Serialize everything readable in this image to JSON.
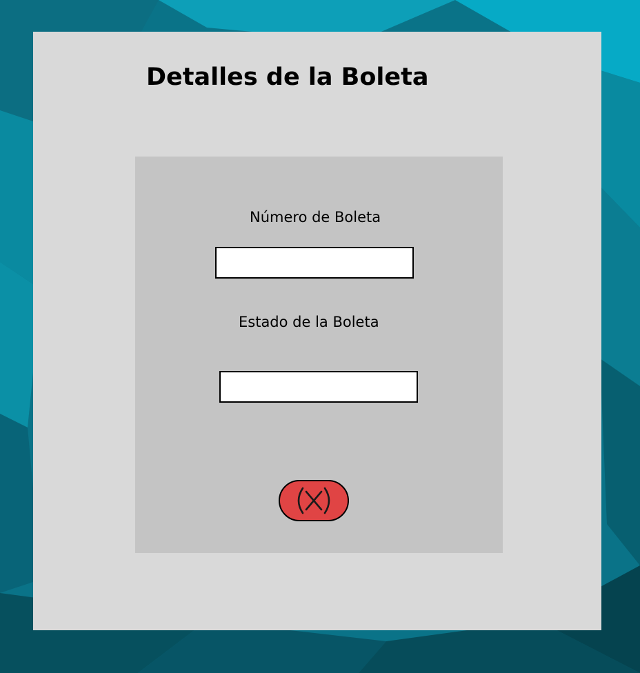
{
  "page": {
    "title": "Detalles de la Boleta"
  },
  "form": {
    "numero_label": "Número de Boleta",
    "numero_value": "",
    "estado_label": "Estado de la Boleta",
    "estado_value": ""
  },
  "close_button": {
    "icon": "close-circle-icon",
    "color": "#e04444"
  },
  "colors": {
    "panel": "#d9d9d9",
    "card": "#c4c4c4",
    "background": "#0a7f96"
  }
}
